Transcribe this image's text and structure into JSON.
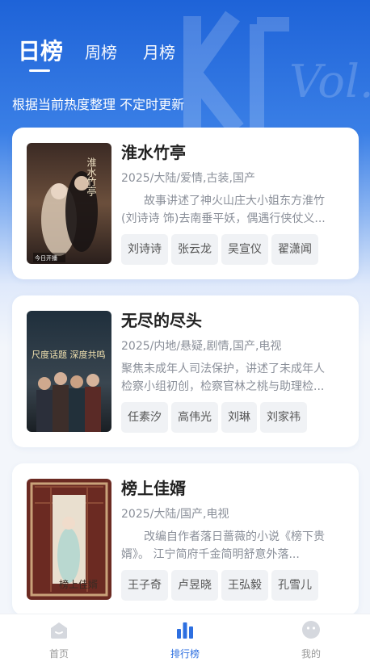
{
  "header": {
    "tabs": [
      {
        "label": "日榜",
        "active": true
      },
      {
        "label": "周榜",
        "active": false
      },
      {
        "label": "月榜",
        "active": false
      }
    ],
    "subtitle": "根据当前热度整理 不定时更新"
  },
  "cards": [
    {
      "title": "淮水竹亭",
      "meta": "2025/大陆/爱情,古装,国产",
      "desc_line1": "故事讲述了神火山庄大小姐东方淮竹",
      "desc_line2": "(刘诗诗 饰)去南垂平妖，偶遇行侠仗义...",
      "actors": [
        "刘诗诗",
        "张云龙",
        "吴宣仪",
        "翟潇闻"
      ],
      "poster_text": "淮水竹亭",
      "poster_badge": "今日开播"
    },
    {
      "title": "无尽的尽头",
      "meta": "2025/内地/悬疑,剧情,国产,电视",
      "desc_line1": "聚焦未成年人司法保护，讲述了未成年人",
      "desc_line2": "检察小组初创，检察官林之桃与助理检...",
      "actors": [
        "任素汐",
        "高伟光",
        "刘琳",
        "刘家祎"
      ],
      "poster_text": "尺度话题 深度共鸣"
    },
    {
      "title": "榜上佳婿",
      "meta": "2025/大陆/国产,电视",
      "desc_line1": "改编自作者落日蔷薇的小说《榜下贵",
      "desc_line2": "婿》。    江宁简府千金简明舒意外落...",
      "actors": [
        "王子奇",
        "卢昱晓",
        "王弘毅",
        "孔雪儿"
      ],
      "poster_text": "榜上佳婿"
    }
  ],
  "bottom_nav": [
    {
      "label": "首页",
      "icon": "home-icon",
      "active": false
    },
    {
      "label": "排行榜",
      "icon": "ranking-icon",
      "active": true
    },
    {
      "label": "我的",
      "icon": "profile-icon",
      "active": false
    }
  ],
  "colors": {
    "accent": "#2d6fe0",
    "header_blue": "#1e63d8",
    "inactive": "#999999"
  }
}
